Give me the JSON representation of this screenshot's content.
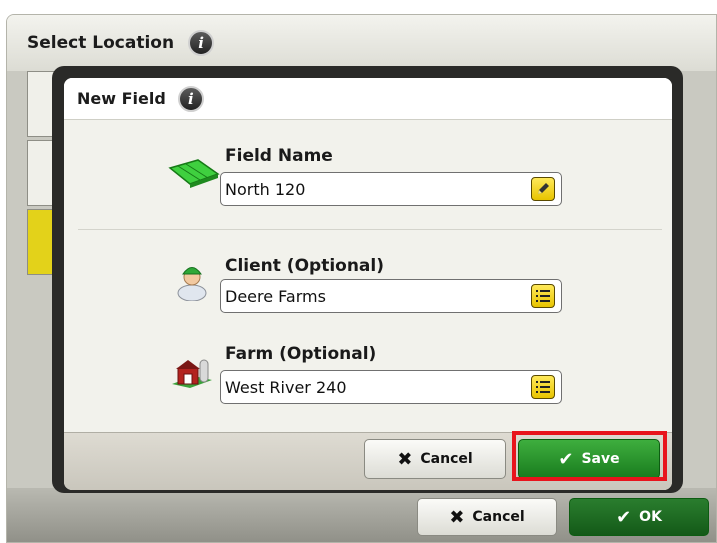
{
  "outer": {
    "title": "Select Location",
    "cancel_label": "Cancel",
    "ok_label": "OK"
  },
  "dialog": {
    "title": "New Field",
    "field_name": {
      "label": "Field Name",
      "value": "North 120"
    },
    "client": {
      "label": "Client (Optional)",
      "value": "Deere Farms"
    },
    "farm": {
      "label": "Farm (Optional)",
      "value": "West River 240"
    },
    "cancel_label": "Cancel",
    "save_label": "Save"
  },
  "icons": {
    "info": "info-icon",
    "field": "field-icon",
    "client": "client-icon",
    "farm": "farm-icon",
    "edit": "pencil-icon",
    "list": "list-icon",
    "cancel": "x-icon",
    "save": "checkmark-icon"
  },
  "colors": {
    "accent_green": "#197c1e",
    "selected_yellow": "#e3d21a",
    "highlight_red": "#e8141c"
  }
}
